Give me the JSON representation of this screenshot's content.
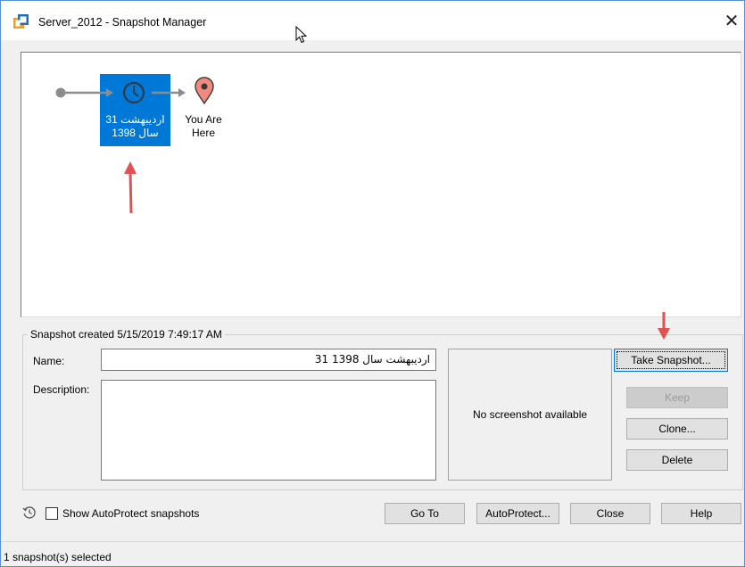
{
  "window": {
    "title": "Server_2012 - Snapshot Manager",
    "close_glyph": "✕"
  },
  "tree": {
    "snapshot_label_line1": "اردیبهشت 31",
    "snapshot_label_line2": "سال 1398",
    "you_are_here_line1": "You Are",
    "you_are_here_line2": "Here"
  },
  "details": {
    "group_title": "Snapshot created 5/15/2019 7:49:17 AM",
    "name_label": "Name:",
    "name_value": "اردیبهشت سال 1398 31",
    "description_label": "Description:",
    "description_value": "",
    "screenshot_text": "No screenshot available"
  },
  "side_buttons": {
    "take_snapshot": "Take Snapshot...",
    "keep": "Keep",
    "clone": "Clone...",
    "delete": "Delete"
  },
  "bottom": {
    "show_autoprotect_label": "Show AutoProtect snapshots",
    "show_autoprotect_checked": false,
    "go_to": "Go To",
    "autoprotect": "AutoProtect...",
    "close": "Close",
    "help": "Help"
  },
  "status": {
    "text": "1 snapshot(s) selected"
  },
  "colors": {
    "selection": "#0078d7",
    "annotation_arrow": "#e05252",
    "location_pin": "#f08a7e"
  }
}
